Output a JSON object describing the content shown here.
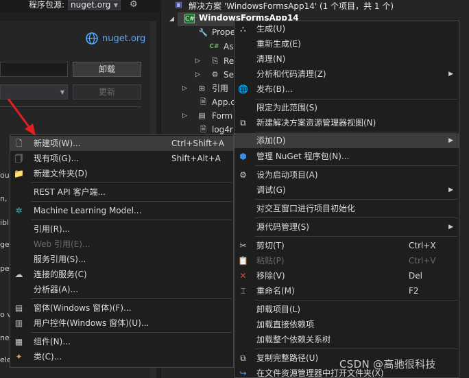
{
  "nuget": {
    "source_label": "程序包源:",
    "source_value": "nuget.org",
    "link_text": "nuget.org",
    "uninstall_label": "卸载",
    "update_label": "更新",
    "fragments": [
      "out",
      "n,",
      "ibl",
      "ge",
      "pe",
      "o v",
      "net",
      "ele"
    ]
  },
  "explorer": {
    "solution_label": "解决方案 'WindowsFormsApp14' (1 个项目，共 1 个)",
    "project_label": "WindowsFormsApp14",
    "items": [
      "Prope",
      "As",
      "Re",
      "Se",
      "引用",
      "App.c",
      "Form",
      "log4r"
    ]
  },
  "main_menu": {
    "items": [
      {
        "label": "生成(U)",
        "shortcut": "",
        "icon": "build-icon",
        "submenu": false,
        "disabled": false
      },
      {
        "label": "重新生成(E)",
        "shortcut": "",
        "icon": "",
        "submenu": false,
        "disabled": false
      },
      {
        "label": "清理(N)",
        "shortcut": "",
        "icon": "",
        "submenu": false,
        "disabled": false
      },
      {
        "label": "分析和代码清理(Z)",
        "shortcut": "",
        "icon": "",
        "submenu": true,
        "disabled": false
      },
      {
        "label": "发布(B)...",
        "shortcut": "",
        "icon": "globe-icon",
        "submenu": false,
        "disabled": false
      },
      {
        "label": "限定为此范围(S)",
        "shortcut": "",
        "icon": "",
        "submenu": false,
        "disabled": false
      },
      {
        "label": "新建解决方案资源管理器视图(N)",
        "shortcut": "",
        "icon": "new-view-icon",
        "submenu": false,
        "disabled": false
      },
      {
        "label": "添加(D)",
        "shortcut": "",
        "icon": "",
        "submenu": true,
        "disabled": false
      },
      {
        "label": "管理 NuGet 程序包(N)...",
        "shortcut": "",
        "icon": "nuget-icon",
        "submenu": false,
        "disabled": false
      },
      {
        "label": "设为启动项目(A)",
        "shortcut": "",
        "icon": "gear-icon",
        "submenu": false,
        "disabled": false
      },
      {
        "label": "调试(G)",
        "shortcut": "",
        "icon": "",
        "submenu": true,
        "disabled": false
      },
      {
        "label": "对交互窗口进行项目初始化",
        "shortcut": "",
        "icon": "",
        "submenu": false,
        "disabled": false
      },
      {
        "label": "源代码管理(S)",
        "shortcut": "",
        "icon": "",
        "submenu": true,
        "disabled": false
      },
      {
        "label": "剪切(T)",
        "shortcut": "Ctrl+X",
        "icon": "scissors-icon",
        "submenu": false,
        "disabled": false
      },
      {
        "label": "粘贴(P)",
        "shortcut": "Ctrl+V",
        "icon": "paste-icon",
        "submenu": false,
        "disabled": true
      },
      {
        "label": "移除(V)",
        "shortcut": "Del",
        "icon": "remove-icon",
        "submenu": false,
        "disabled": false
      },
      {
        "label": "重命名(M)",
        "shortcut": "F2",
        "icon": "rename-icon",
        "submenu": false,
        "disabled": false
      },
      {
        "label": "卸载项目(L)",
        "shortcut": "",
        "icon": "",
        "submenu": false,
        "disabled": false
      },
      {
        "label": "加载直接依赖项",
        "shortcut": "",
        "icon": "",
        "submenu": false,
        "disabled": false
      },
      {
        "label": "加载整个依赖关系树",
        "shortcut": "",
        "icon": "",
        "submenu": false,
        "disabled": false
      },
      {
        "label": "复制完整路径(U)",
        "shortcut": "",
        "icon": "copy-icon",
        "submenu": false,
        "disabled": false
      },
      {
        "label": "在文件资源管理器中打开文件夹(X)",
        "shortcut": "",
        "icon": "open-folder-icon",
        "submenu": false,
        "disabled": false
      }
    ]
  },
  "sub_menu": {
    "items": [
      {
        "label": "新建项(W)...",
        "shortcut": "Ctrl+Shift+A",
        "icon": "new-item-icon",
        "disabled": false
      },
      {
        "label": "现有项(G)...",
        "shortcut": "Shift+Alt+A",
        "icon": "existing-item-icon",
        "disabled": false
      },
      {
        "label": "新建文件夹(D)",
        "shortcut": "",
        "icon": "new-folder-icon",
        "disabled": false
      },
      {
        "label": "REST API 客户端...",
        "shortcut": "",
        "icon": "",
        "disabled": false
      },
      {
        "label": "Machine Learning Model...",
        "shortcut": "",
        "icon": "ml-model-icon",
        "disabled": false
      },
      {
        "label": "引用(R)...",
        "shortcut": "",
        "icon": "",
        "disabled": false
      },
      {
        "label": "Web 引用(E)...",
        "shortcut": "",
        "icon": "",
        "disabled": true
      },
      {
        "label": "服务引用(S)...",
        "shortcut": "",
        "icon": "",
        "disabled": false
      },
      {
        "label": "连接的服务(C)",
        "shortcut": "",
        "icon": "connected-service-icon",
        "disabled": false
      },
      {
        "label": "分析器(A)...",
        "shortcut": "",
        "icon": "",
        "disabled": false
      },
      {
        "label": "窗体(Windows 窗体)(F)...",
        "shortcut": "",
        "icon": "form-icon",
        "disabled": false
      },
      {
        "label": "用户控件(Windows 窗体)(U)...",
        "shortcut": "",
        "icon": "user-control-icon",
        "disabled": false
      },
      {
        "label": "组件(N)...",
        "shortcut": "",
        "icon": "component-icon",
        "disabled": false
      },
      {
        "label": "类(C)...",
        "shortcut": "",
        "icon": "class-icon",
        "disabled": false
      }
    ]
  },
  "watermark": "CSDN @高驰很科技",
  "colors": {
    "accent": "#55aaff",
    "arrow": "#e02020",
    "menu_bg": "#1e1e1e",
    "highlight": "#3c3c3c"
  }
}
